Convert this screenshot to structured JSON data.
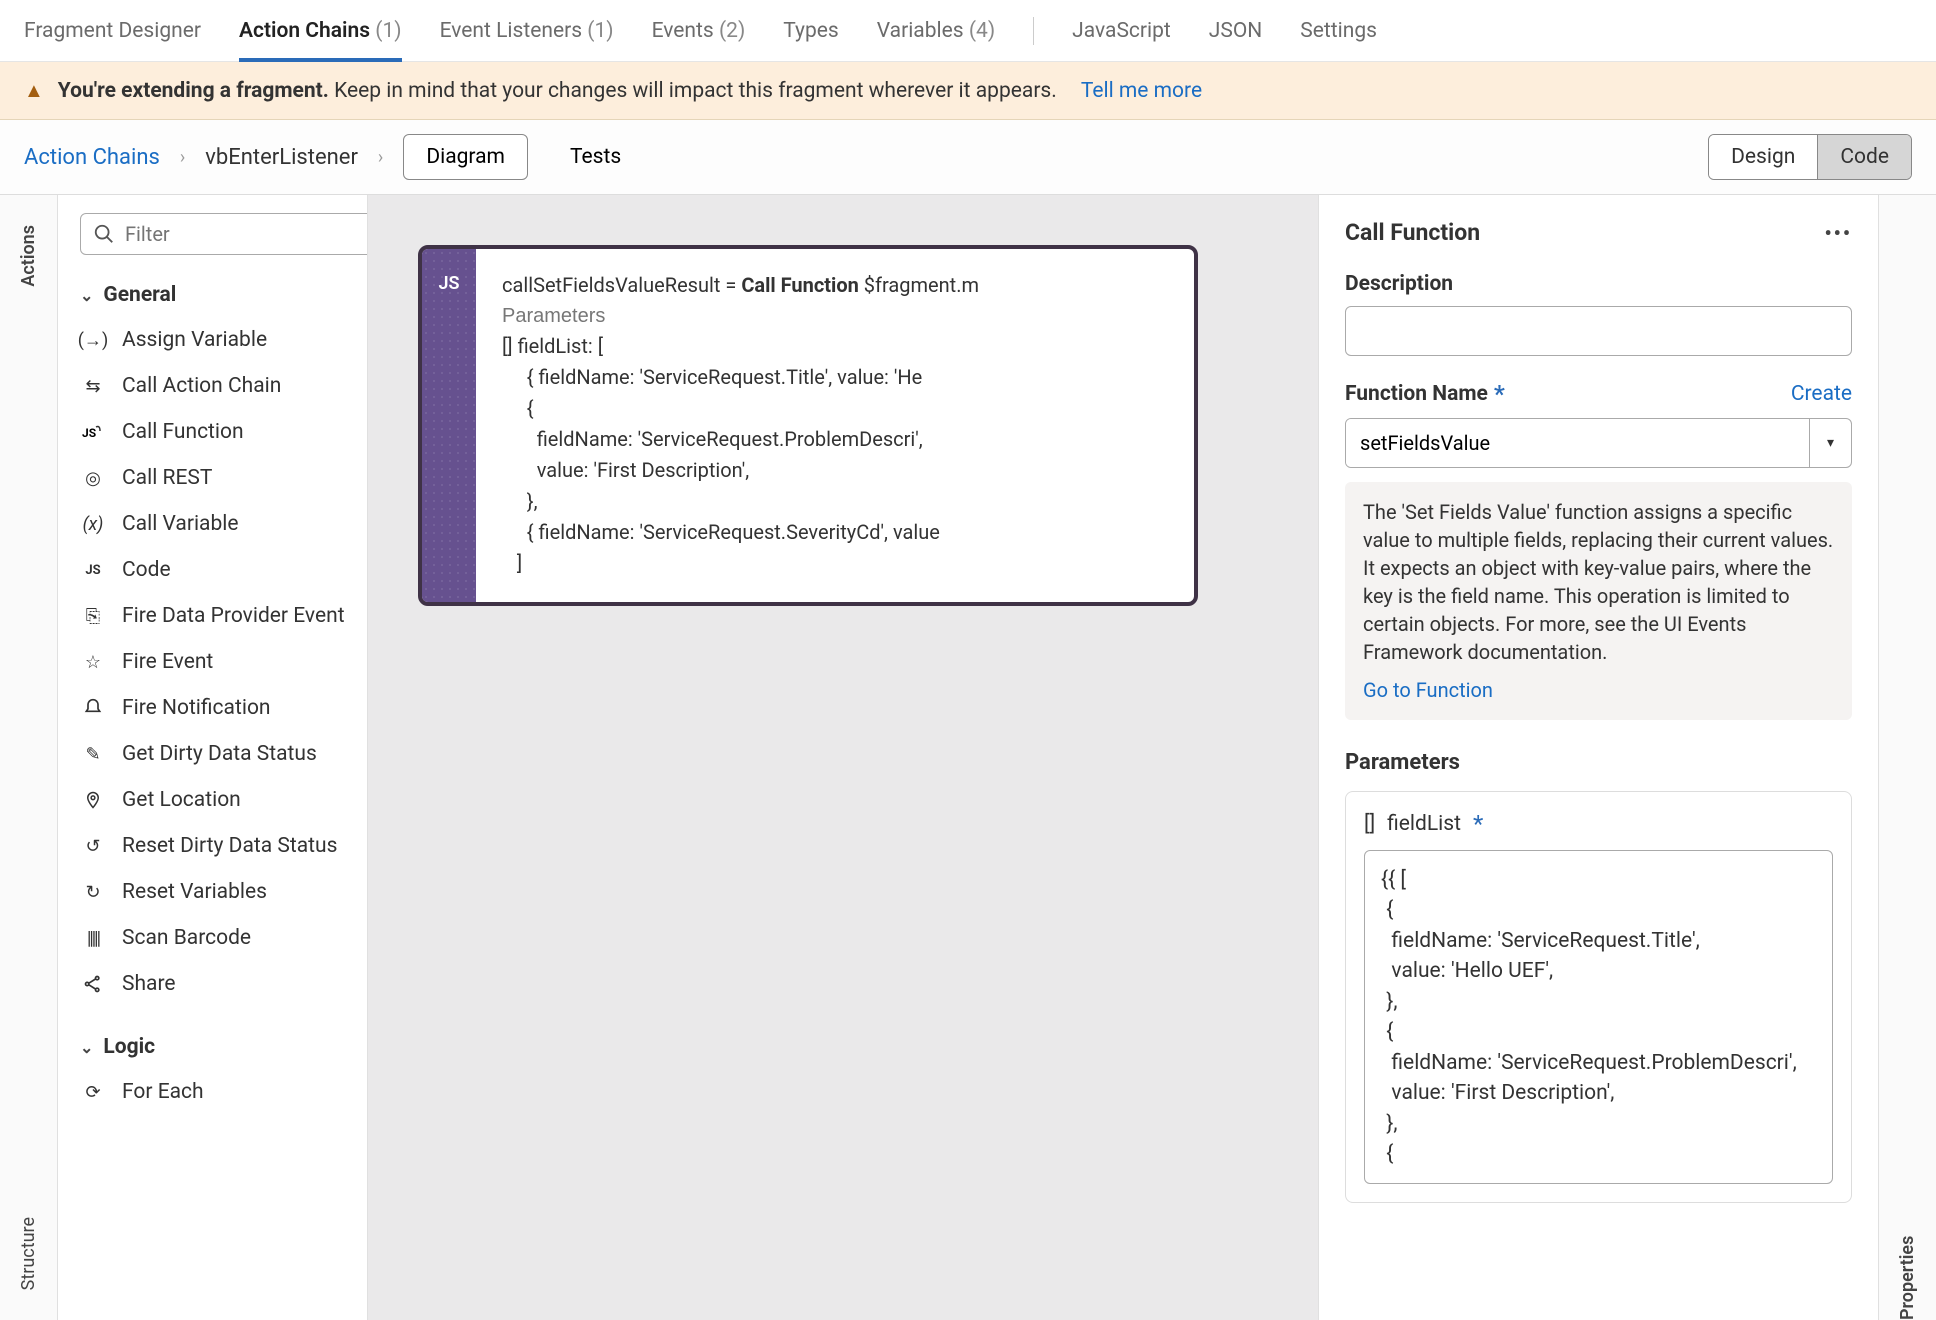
{
  "top_tabs": [
    {
      "label": "Fragment Designer",
      "count": null,
      "active": false
    },
    {
      "label": "Action Chains",
      "count": "(1)",
      "active": true
    },
    {
      "label": "Event Listeners",
      "count": "(1)",
      "active": false
    },
    {
      "label": "Events",
      "count": "(2)",
      "active": false
    },
    {
      "label": "Types",
      "count": null,
      "active": false
    },
    {
      "label": "Variables",
      "count": "(4)",
      "active": false
    },
    {
      "label": "JavaScript",
      "count": null,
      "active": false
    },
    {
      "label": "JSON",
      "count": null,
      "active": false
    },
    {
      "label": "Settings",
      "count": null,
      "active": false
    }
  ],
  "warning": {
    "bold": "You're extending a fragment.",
    "text": "Keep in mind that your changes will impact this fragment wherever it appears.",
    "link": "Tell me more"
  },
  "breadcrumb": {
    "root": "Action Chains",
    "current": "vbEnterListener",
    "diagram": "Diagram",
    "tests": "Tests",
    "design": "Design",
    "code": "Code"
  },
  "left_rail": {
    "actions": "Actions",
    "structure": "Structure"
  },
  "filter": {
    "placeholder": "Filter"
  },
  "sections": {
    "general": "General",
    "logic": "Logic"
  },
  "actions_general": [
    "Assign Variable",
    "Call Action Chain",
    "Call Function",
    "Call REST",
    "Call Variable",
    "Code",
    "Fire Data Provider Event",
    "Fire Event",
    "Fire Notification",
    "Get Dirty Data Status",
    "Get Location",
    "Reset Dirty Data Status",
    "Reset Variables",
    "Scan Barcode",
    "Share"
  ],
  "actions_logic": [
    "For Each"
  ],
  "code_node": {
    "gutter": "JS",
    "line1_pre": "callSetFieldsValueResult = ",
    "line1_bold": "Call Function",
    "line1_post": " $fragment.m",
    "params_label": "Parameters",
    "body": "[] fieldList: [\n     { fieldName: 'ServiceRequest.Title', value: 'He\n     {\n       fieldName: 'ServiceRequest.ProblemDescri',\n       value: 'First Description',\n     },\n     { fieldName: 'ServiceRequest.SeverityCd', value\n   ]"
  },
  "properties": {
    "title": "Call Function",
    "description_label": "Description",
    "description_value": "",
    "function_name_label": "Function Name",
    "create": "Create",
    "function_name_value": "setFieldsValue",
    "help_text": "The 'Set Fields Value' function assigns a specific value to multiple fields, replacing their current values. It expects an object with key-value pairs, where the key is the field name. This operation is limited to certain objects. For more, see the UI Events Framework documentation.",
    "goto": "Go to Function",
    "parameters_label": "Parameters",
    "param_name": "fieldList",
    "param_bracket": "[]",
    "param_value": "{{ [\n {\n  fieldName: 'ServiceRequest.Title',\n  value: 'Hello UEF',\n },\n {\n  fieldName: 'ServiceRequest.ProblemDescri',\n  value: 'First Description',\n },\n {"
  },
  "right_rail": {
    "properties": "Properties"
  }
}
